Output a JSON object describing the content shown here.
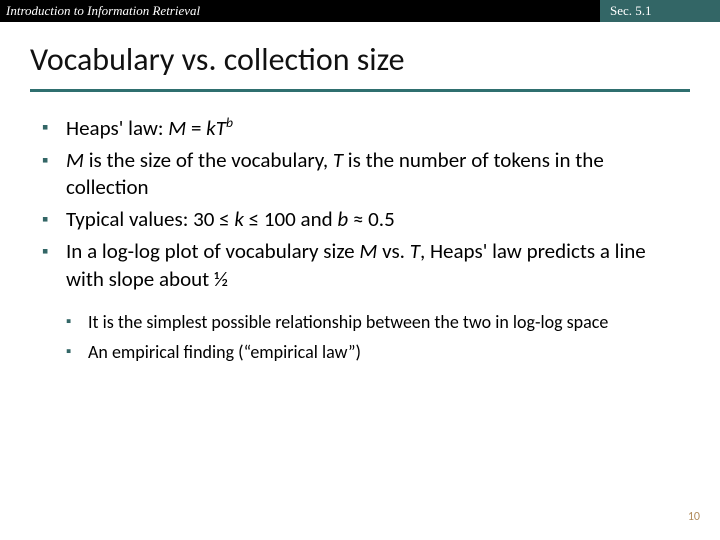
{
  "header": {
    "left": "Introduction to Information Retrieval",
    "right": "Sec. 5.1"
  },
  "title": "Vocabulary vs. collection size",
  "bullets": {
    "b1_pre": "Heaps' law: ",
    "b1_m": "M",
    "b1_eq": " = ",
    "b1_k": "k",
    "b1_t": "T",
    "b1_sup": "b",
    "b2_m": "M",
    "b2_mid": " is the size of the vocabulary, ",
    "b2_t": "T",
    "b2_end": " is the number of tokens in the collection",
    "b3_pre": "Typical values: 30 ≤ ",
    "b3_k": "k",
    "b3_mid": " ≤ 100 and ",
    "b3_b": "b",
    "b3_end": " ≈ 0.5",
    "b4_pre": "In a log-log plot of vocabulary size ",
    "b4_m": "M",
    "b4_mid": " vs. ",
    "b4_t": "T",
    "b4_end": ", Heaps' law predicts a line with slope about ½"
  },
  "sub": {
    "s1": "It is the simplest possible relationship between the two in log-log space",
    "s2": "An empirical finding (“empirical law”)"
  },
  "page_number": "10"
}
